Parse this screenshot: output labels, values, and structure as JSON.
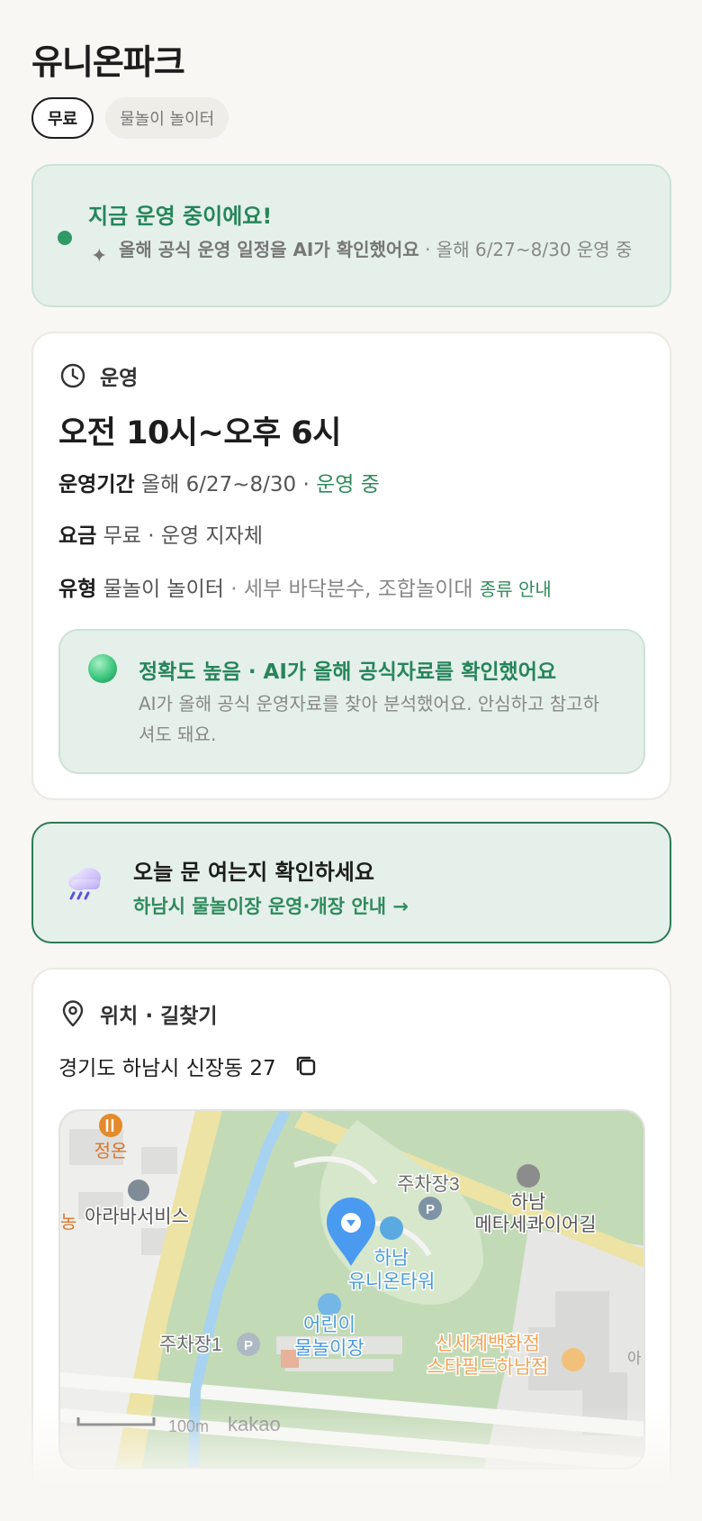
{
  "header": {
    "title": "유니온파크"
  },
  "chips": [
    {
      "label": "무료"
    },
    {
      "label": "물놀이 놀이터"
    }
  ],
  "status": {
    "title": "지금 운영 중이에요!",
    "sub_bold": "올해 공식 운영 일정을 AI가 확인했어요",
    "sub_rest": " · 올해 6/27~8/30 운영 중"
  },
  "operation": {
    "heading": "운영",
    "hours": "오전 10시~오후 6시",
    "period_label": "운영기간",
    "period_value": "올해 6/27~8/30 · ",
    "period_status": "운영 중",
    "fee_label": "요금",
    "fee_value": "무료 · 운영 지자체",
    "type_label": "유형",
    "type_value": "물놀이 놀이터",
    "type_detail": " · 세부 바닥분수, 조합놀이대 ",
    "type_link": "종류 안내",
    "accuracy": {
      "title": "정확도 높음 · AI가 올해 공식자료를 확인했어요",
      "desc": "AI가 올해 공식 운영자료를 찾아 분석했어요. 안심하고 참고하셔도 돼요."
    }
  },
  "notice": {
    "title": "오늘 문 여는지 확인하세요",
    "link": "하남시 물놀이장 운영·개장 안내 →"
  },
  "location": {
    "heading": "위치 · 길찾기",
    "address": "경기도 하남시 신장동 27"
  },
  "map": {
    "labels": {
      "jungon": "정온",
      "arabus": "아라바서비스",
      "parking3": "주차장3",
      "hanam_meta_1": "하남",
      "hanam_meta_2": "메타세콰이어길",
      "tower_1": "하남",
      "tower_2": "유니온타워",
      "kids_1": "어린이",
      "kids_2": "물놀이장",
      "parking1": "주차장1",
      "shinsegae_1": "신세계백화점",
      "shinsegae_2": "스타필드하남점",
      "edge_right": "아",
      "edge_left": "농",
      "scale": "100m",
      "brand": "kakao"
    }
  },
  "colors": {
    "accent": "#2f8a5d",
    "status_bg": "#e5f0eb",
    "pin": "#4a9bf0"
  }
}
